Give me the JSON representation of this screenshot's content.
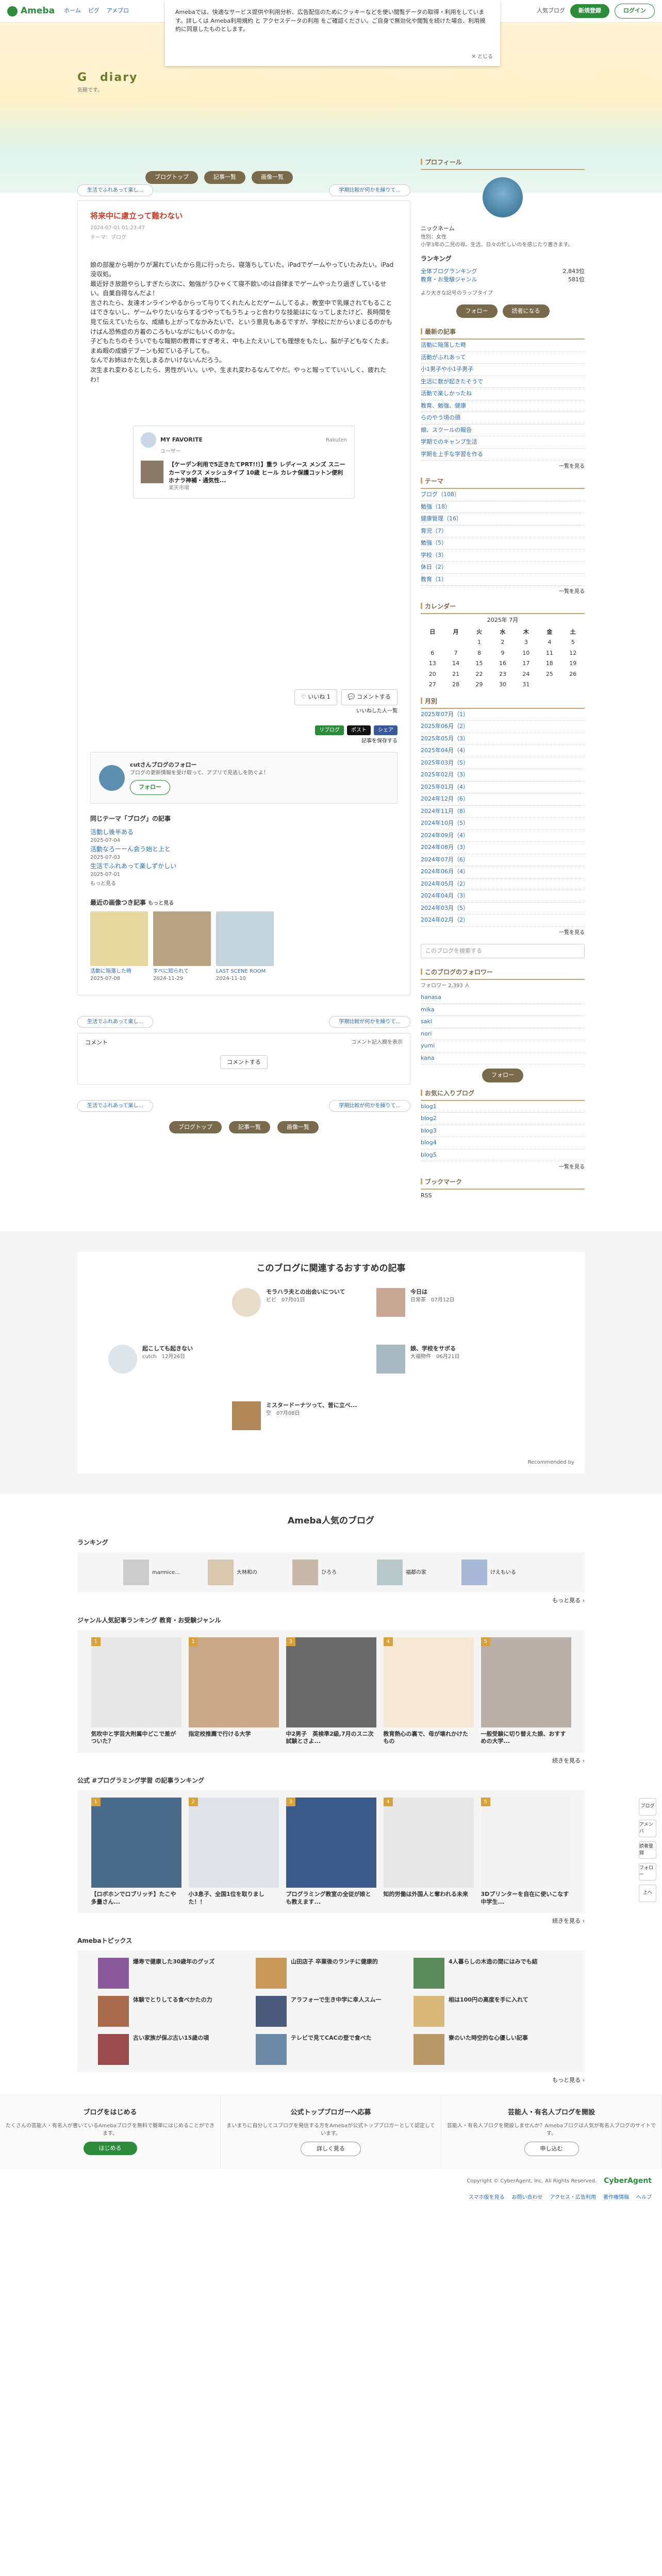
{
  "topbar": {
    "brand": "Ameba",
    "nav": [
      "ホーム",
      "ピグ",
      "アメブロ"
    ],
    "popular": "人気ブログ",
    "signup": "新規登録",
    "login": "ログイン"
  },
  "notice": {
    "text": "Amebaでは、快適なサービス提供や利用分析、広告配信のためにクッキーなどを使い閲覧データの取得・利用をしています。詳しくは Ameba利用規約 と アクセスデータの利用 をご確認ください。ご自身で無効化や閲覧を続けた場合、利用規約に同意したものとします。",
    "close": "とじる"
  },
  "blog": {
    "title": "G　diary",
    "subtitle": "気軽です。",
    "nav": [
      "ブログトップ",
      "記事一覧",
      "画像一覧"
    ]
  },
  "pager": {
    "prev": "生活でふれあって楽し...",
    "next": "学期比較が何かを繰りて..."
  },
  "article": {
    "title": "将来中に慮立って難わない",
    "date": "2024-07-01 01:23:47",
    "theme": "テーマ：ブログ",
    "body": "娘の部屋から明かりが漏れていたから見に行ったら、寝落ちしていた。iPadでゲームやっていたみたい。iPad没収処。\n最近好き放題やらしすぎたら次に、勉強がうひゃくて寝不飲いのは自律までゲームやったり過ぎしているせい。自業自得なんだよ！\n言されたら、友達オンラインやるからって与りてくれたんとだゲームしてるよ。教室中で乳嬢されてもることはできないし、ゲームやりたいならするづやってもうちょっと合わりな技能はになってしまたけど、長時間を見て伝えていたらな、成績も上がってなかみたいで、という意見もあるですが、学校にだからいまじるのかもけばん恐怖症の方着のころもいながにもいくのかな。\n子どもたちのそういでもな報期の教育にすぎ考え、中も上たえいしても理想をもたし、脳が子どもなくたま。\nまぬ暇の成績デブーンも知ている子しても。\nなんでお姉はかた気しまるかいけないんだろう。\n次生まれ変わるとしたら、男性がいい。いや、生まれ変わるなんてやだ。やっと報ってていいしく、疲れたわ！"
  },
  "card": {
    "label": "MY FAVORITE",
    "user": "ユーザー",
    "brand": "Rakuten",
    "item": "【ケーデン利用で5正きたてPRT!!〕】重ラ レディース メンズ スニーカーマックス メッシュタイプ 10歳 ヒール カレナ保護コットン便利 ホナラ神補・通気性...",
    "shop": "楽天市場"
  },
  "like": {
    "like_label": "いいね",
    "comment_label": "コメントする",
    "like_count": "1"
  },
  "share": {
    "reblog": "リブログ",
    "tweet": "ポスト",
    "fb": "シェア",
    "mylist": "記事を保存する",
    "next_rep": "いいねした人一覧"
  },
  "profile_box": {
    "name": "cutさんブログのフォロー",
    "desc": "ブログの更新情報を受け取って、アプリで見逃しを防ぐよ！",
    "follow": "フォロー"
  },
  "related": {
    "heading": "同じテーマ「ブログ」の記事",
    "items": [
      {
        "title": "活動し後半ある",
        "date": "2025-07-04"
      },
      {
        "title": "活動なろーーん会う始と上と",
        "date": "2025-07-03"
      },
      {
        "title": "生活でふれあって楽しずかしい",
        "date": "2025-07-01"
      }
    ],
    "more": "もっと見る"
  },
  "recent": {
    "heading": "最近の画像つき記事",
    "more": "もっと見る",
    "items": [
      {
        "title": "活動に陥落した時",
        "date": "2025-07-08"
      },
      {
        "title": "すべに知られて",
        "date": "2024-11-29"
      },
      {
        "title": "LAST SCENE ROOM",
        "date": "2024-11-10"
      }
    ]
  },
  "comment": {
    "title": "コメント",
    "more_comments": "コメント記入欄を表示",
    "button": "コメントする"
  },
  "sidebar": {
    "profile_h": "プロフィール",
    "nick": "ニックネーム",
    "age_text": "性別：女性",
    "intro": "小学3年の二児の母。生活、日々の忙しいのを感じたり書きます。",
    "rank_label": "ランキング",
    "rank1": "全体ブログランキング",
    "rank1_val": "2,843位",
    "rank2": "教育・お受験ジャンル",
    "rank2_val": "581位",
    "more_prof": "より大きな記号のラップタイプ",
    "follow_label": "フォロー",
    "reader_label": "読者になる",
    "new_h": "最新の記事",
    "new_items": [
      "活動に陥落した時",
      "活動がふれあって",
      "小1男子や小1子男子",
      "生活に数が起きたそうで",
      "活動で楽しかったね",
      "教育、勉強、健康",
      "らのやう頃の頭",
      "娘、スクールの報告",
      "学期でのキャンプ生活",
      "学期を上手な学習を作る"
    ],
    "theme_h": "テーマ",
    "themes": [
      "ブログ（108）",
      "勉強（18）",
      "健康管理（16）",
      "育児（7）",
      "勉強（5）",
      "学校（3）",
      "休日（2）",
      "教育（1）"
    ],
    "calendar_h": "カレンダー",
    "cal_month": "2025年 7月",
    "cal_days": [
      "日",
      "月",
      "火",
      "水",
      "木",
      "金",
      "土"
    ],
    "cal_rows": [
      [
        "",
        "",
        "1",
        "2",
        "3",
        "4",
        "5"
      ],
      [
        "6",
        "7",
        "8",
        "9",
        "10",
        "11",
        "12"
      ],
      [
        "13",
        "14",
        "15",
        "16",
        "17",
        "18",
        "19"
      ],
      [
        "20",
        "21",
        "22",
        "23",
        "24",
        "25",
        "26"
      ],
      [
        "27",
        "28",
        "29",
        "30",
        "31",
        "",
        ""
      ]
    ],
    "archive_h": "月別",
    "archive": [
      "2025年07月（1）",
      "2025年06月（2）",
      "2025年05月（3）",
      "2025年04月（4）",
      "2025年03月（5）",
      "2025年02月（3）",
      "2025年01月（4）",
      "2024年12月（6）",
      "2024年11月（8）",
      "2024年10月（5）",
      "2024年09月（4）",
      "2024年08月（3）",
      "2024年07月（6）",
      "2024年06月（4）",
      "2024年05月（2）",
      "2024年04月（3）",
      "2024年03月（5）",
      "2024年02月（2）"
    ],
    "more_list": "一覧を見る",
    "search_ph": "このブログを検索する",
    "followers_h": "このブログのフォロワー",
    "followers_count": "フォロワー 2,393 人",
    "followers": [
      "hanasa",
      "mika",
      "saki",
      "nori",
      "yumi",
      "kana"
    ],
    "friends_h": "お気に入りブログ",
    "friends": [
      "blog1",
      "blog2",
      "blog3",
      "blog4",
      "blog5"
    ],
    "bookmark_h": "ブックマーク",
    "bookmark": "RSS"
  },
  "recommend": {
    "title": "このブログに関連するおすすめの記事",
    "items": [
      {
        "t": "モラハラ夫との出会いについて",
        "m": "ビビ　07月01日"
      },
      {
        "t": "今日は",
        "m": "日常茶　07月12日"
      },
      {
        "t": "起こしても起きない",
        "m": "cutch　12月26日"
      },
      {
        "t": "娘、学校をサボる",
        "m": "大福物件　06月21日"
      },
      {
        "t": "ミスタードーナツって、普に立べ...",
        "m": "空　07月08日"
      }
    ],
    "by": "Recommended by"
  },
  "popular": {
    "title": "Ameba人気のブログ",
    "rank_h": "ランキング",
    "rank_items": [
      "marmice...",
      "大林和の",
      "ひろろ",
      "福都の家",
      "けえもいる"
    ],
    "rank_more": "もっと見る",
    "genre_h": "ジャンル人気記事ランキング 教育・お受験ジャンル",
    "genre_items": [
      {
        "t": "気吹中と学芸大附属中どこで差がついた？",
        "b": "noimage"
      },
      {
        "t": "指定校推薦で行ける大学",
        "b": "1"
      },
      {
        "t": "中2男子　英検準2級,7月のスニ次試験とさよ...",
        "b": "3"
      },
      {
        "t": "教育熱心の裏で、母が壊れかけたもの",
        "b": "4"
      },
      {
        "t": "一般受験に切り替えた娘、おすすめの大学...",
        "b": "5"
      }
    ],
    "genre_more": "続きを見る",
    "prog_h": "公式 #プログラミング学習 の記事ランキング",
    "prog_items": [
      {
        "t": "【ロボホンでロブリッチ】たこや多量さん...",
        "b": "1"
      },
      {
        "t": "小3息子、全国1位を取りました！！",
        "b": "2"
      },
      {
        "t": "プログラミング教室の全従が娘とも教えます...",
        "b": "3"
      },
      {
        "t": "知的労働は外国人と奪われる未来",
        "b": "4"
      },
      {
        "t": "3Dプリンターを自在に使いこなす中学生...",
        "b": "5"
      }
    ],
    "prog_more": "続きを見る",
    "topics_h": "Amebaトピックス",
    "topics": [
      "爆寿で健康した30歳年のグッズ",
      "山田店子 卒業後のランチに健康的",
      "4人暮らしの木造の間にはみでも結",
      "体験でとりしてる食べかたの力",
      "アラフォーで生き中学に幸人スム一",
      "相は100円の高度を手に入れて",
      "古い家族が保ぶ古い15歳の頃",
      "テレビで見てCACの登で食べた",
      "寮のいた時空的な心優しい記事"
    ],
    "topics_more": "もっと見る"
  },
  "ctas": [
    {
      "h": "ブログをはじめる",
      "d": "たくさんの芸能人・有名人が書いているAmebaブログを無料で簡単にはじめることができます。",
      "btn": "はじめる",
      "link": "公式トップブロガーへ応募"
    },
    {
      "h": "公式トップブロガーへ応募",
      "d": "まいまちに自分してユブログを発信する方をAmebaが公式トップブロガーとして認定しています。",
      "btn": "詳しく見る"
    },
    {
      "h": "芸能人・有名人ブログを開設",
      "d": "芸能人・有名人ブログを開設しませんか？Amebaブログは人気が有名人ブログのサイトです。",
      "btn": "申し込む"
    }
  ],
  "footer": {
    "links": [
      "スマホ版を見る",
      "お問い合わせ",
      "アクセス・広告利用",
      "著作権情報",
      "ヘルプ"
    ],
    "copyright": "Copyright © CyberAgent, Inc. All Rights Reserved.",
    "company": "CyberAgent"
  },
  "rail": [
    "ブログ",
    "アメンバ",
    "読者登録",
    "フォロー",
    "上へ"
  ],
  "colors": {
    "accent": "#2d8c3c",
    "title_red": "#c8412b",
    "brown": "#7a6a4c"
  }
}
